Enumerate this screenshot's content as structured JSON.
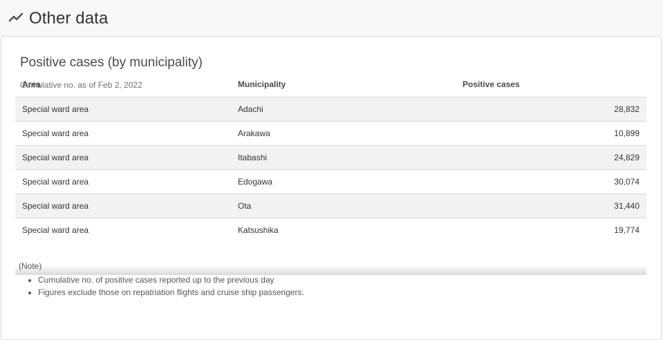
{
  "section": {
    "title": "Other data",
    "icon": "line-chart-icon"
  },
  "card": {
    "title": "Positive cases (by municipality)",
    "subtitle": "Cumulative no. as of Feb 2, 2022",
    "table": {
      "headers": [
        "Area",
        "Municipality",
        "Positive cases"
      ],
      "rows": [
        [
          "Special ward area",
          "Adachi",
          "28,832"
        ],
        [
          "Special ward area",
          "Arakawa",
          "10,899"
        ],
        [
          "Special ward area",
          "Itabashi",
          "24,829"
        ],
        [
          "Special ward area",
          "Edogawa",
          "30,074"
        ],
        [
          "Special ward area",
          "Ota",
          "31,440"
        ],
        [
          "Special ward area",
          "Katsushika",
          "19,774"
        ]
      ]
    },
    "note": {
      "label": "(Note)",
      "items": [
        "Cumulative no. of positive cases reported up to the previous day",
        "Figures exclude those on repatriation flights and cruise ship passengers."
      ]
    }
  }
}
